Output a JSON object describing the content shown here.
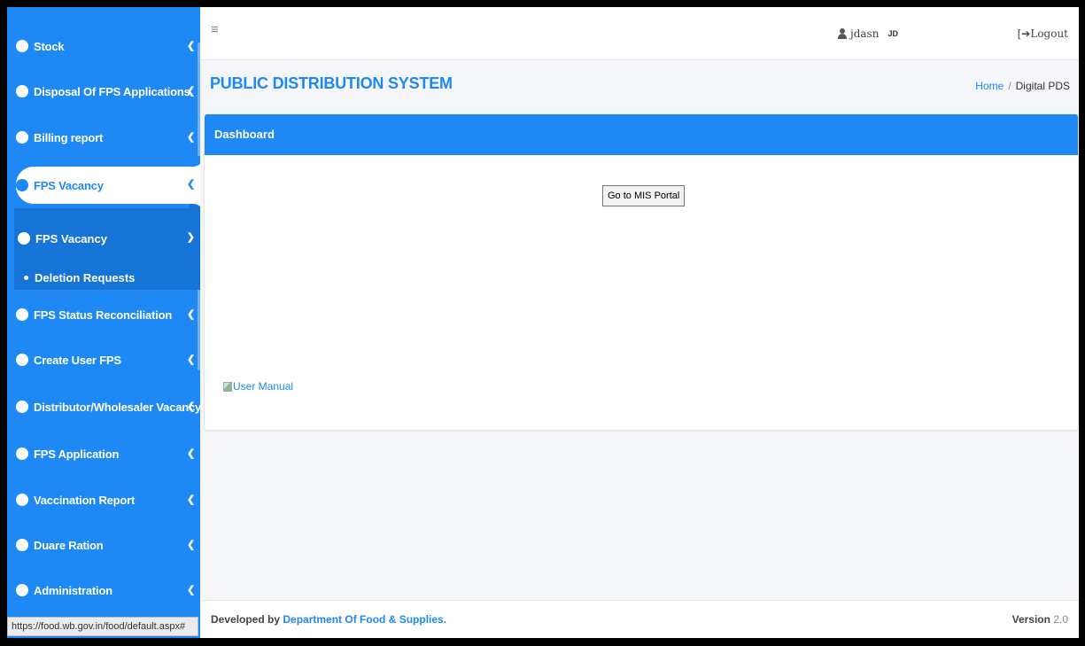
{
  "sidebar": {
    "items": [
      {
        "label": "Stock"
      },
      {
        "label": "Disposal Of FPS Applications"
      },
      {
        "label": "Billing report"
      },
      {
        "label": "FPS Vacancy"
      },
      {
        "label": "FPS Status Reconciliation"
      },
      {
        "label": "Create User FPS"
      },
      {
        "label": "Distributor/Wholesaler Vacancy"
      },
      {
        "label": "FPS Application"
      },
      {
        "label": "Vaccination Report"
      },
      {
        "label": "Duare Ration"
      },
      {
        "label": "Administration"
      }
    ],
    "submenu": {
      "label": "FPS Vacancy",
      "children": [
        {
          "label": "Deletion Requests"
        }
      ]
    },
    "active_item": "FPS Vacancy",
    "colors": {
      "primary": "#1e88f5",
      "submenu_bg": "#1574d6"
    }
  },
  "topbar": {
    "menu_icon": "hamburger-icon",
    "username": "jdasn",
    "initials": "JD",
    "logout_label": "Logout",
    "user_icon": "user-icon",
    "logout_icon": "sign-out-icon"
  },
  "header": {
    "title": "PUBLIC DISTRIBUTION SYSTEM",
    "breadcrumb": {
      "home": "Home",
      "separator": "/",
      "current": "Digital PDS"
    }
  },
  "card": {
    "title": "Dashboard",
    "mis_button": "Go to MIS Portal",
    "user_manual": "User Manual"
  },
  "footer": {
    "developed_by": "Developed by",
    "department": "Department Of Food & Supplies.",
    "version_label": "Version",
    "version": "2.0"
  },
  "status_bar": {
    "url": "https://food.wb.gov.in/food/default.aspx#"
  }
}
